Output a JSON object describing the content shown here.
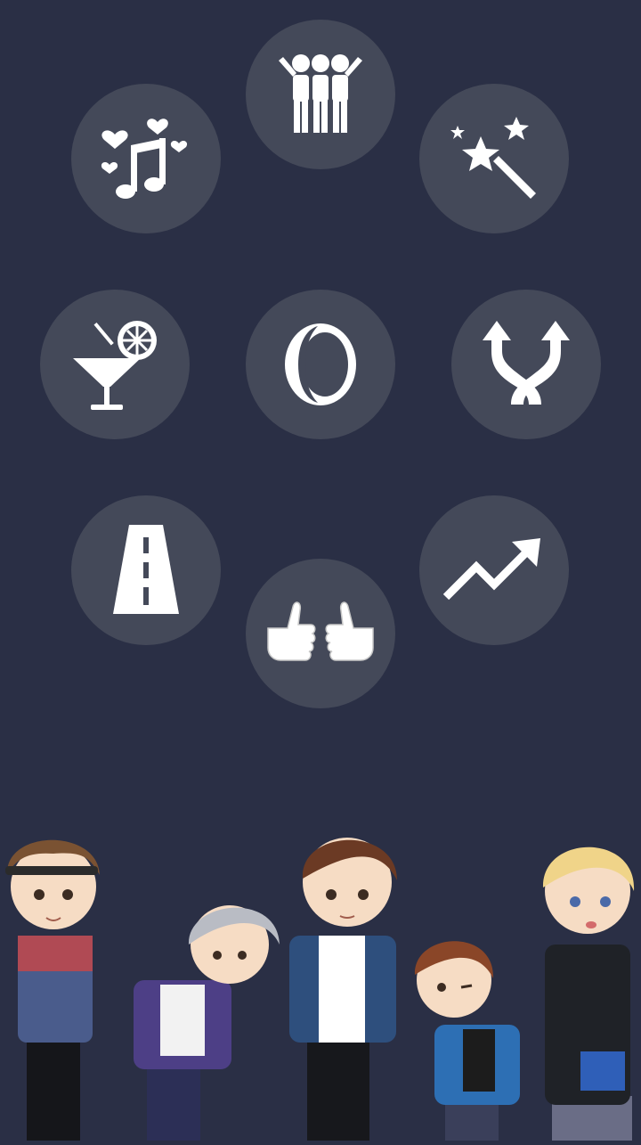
{
  "screen": {
    "background_color": "#2a2f45",
    "button_color": "#444959",
    "icon_color": "#ffffff"
  },
  "menu": {
    "buttons": [
      {
        "id": "people",
        "icon": "group-of-people-icon"
      },
      {
        "id": "music",
        "icon": "music-note-hearts-icon"
      },
      {
        "id": "magic",
        "icon": "magic-wand-stars-icon"
      },
      {
        "id": "cocktail",
        "icon": "cocktail-glass-icon"
      },
      {
        "id": "ring",
        "icon": "ring-icon"
      },
      {
        "id": "cross",
        "icon": "crossing-arrows-icon"
      },
      {
        "id": "road",
        "icon": "road-icon"
      },
      {
        "id": "trend",
        "icon": "trending-up-arrow-icon"
      },
      {
        "id": "thumbs",
        "icon": "two-thumbs-up-icon"
      }
    ]
  },
  "artwork": {
    "subject": "chibi-band-illustration",
    "members": [
      {
        "hair": "#7a5232",
        "jacket": "#36507e"
      },
      {
        "hair": "#b9bcc4",
        "jacket": "#4d3f86"
      },
      {
        "hair": "#6b3a24",
        "jacket": "#2e4f7d"
      },
      {
        "hair": "#8a4628",
        "jacket": "#2d6fb4"
      },
      {
        "hair": "#f0d489",
        "jacket": "#1f2227"
      }
    ]
  }
}
